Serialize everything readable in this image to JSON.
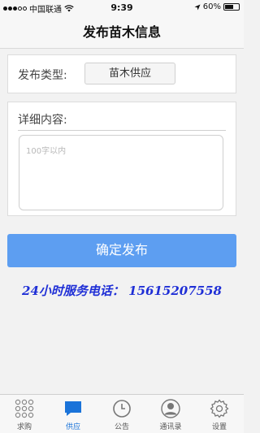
{
  "status": {
    "carrier": "中国联通",
    "time": "9:39",
    "battery_text": "60%",
    "battery_level": 0.6
  },
  "header": {
    "title": "发布苗木信息"
  },
  "form": {
    "type_label": "发布类型:",
    "type_value": "苗木供应",
    "detail_label": "详细内容:",
    "detail_placeholder": "100字以内",
    "detail_value": ""
  },
  "submit_label": "确定发布",
  "hotline": "24小时服务电话： 15615207558",
  "tabs": [
    {
      "label": "求购",
      "icon": "grid-dots-icon",
      "active": false
    },
    {
      "label": "供应",
      "icon": "chat-bubble-icon",
      "active": true
    },
    {
      "label": "公告",
      "icon": "clock-icon",
      "active": false
    },
    {
      "label": "通讯录",
      "icon": "person-icon",
      "active": false
    },
    {
      "label": "设置",
      "icon": "gear-icon",
      "active": false
    }
  ],
  "colors": {
    "accent": "#5d9ef1",
    "active_tab": "#1a73d9",
    "hotline": "#1f2fd6"
  }
}
